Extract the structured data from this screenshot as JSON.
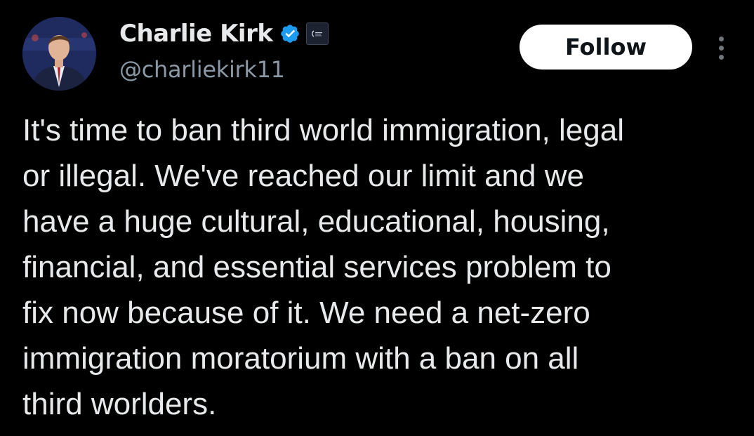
{
  "author": {
    "display_name": "Charlie Kirk",
    "handle": "@charliekirk11",
    "verified_badge_icon": "verified-check-icon",
    "affiliate_badge_icon": "organization-affiliate-icon"
  },
  "actions": {
    "follow_label": "Follow",
    "more_icon": "more-vertical-icon"
  },
  "tweet": {
    "text_lines": [
      "It's time to ban third world immigration, legal",
      "or illegal. We've reached our limit and we",
      "have a huge cultural, educational, housing,",
      "financial, and essential services problem to",
      "fix now because of it. We need a net-zero",
      "immigration moratorium with a ban on all",
      "third worlders."
    ]
  },
  "colors": {
    "background": "#000000",
    "primary_text": "#e7e9ea",
    "secondary_text": "#8b98a5",
    "verified_blue": "#1d9bf0",
    "follow_button_bg": "#ffffff",
    "follow_button_text": "#0f1419"
  }
}
